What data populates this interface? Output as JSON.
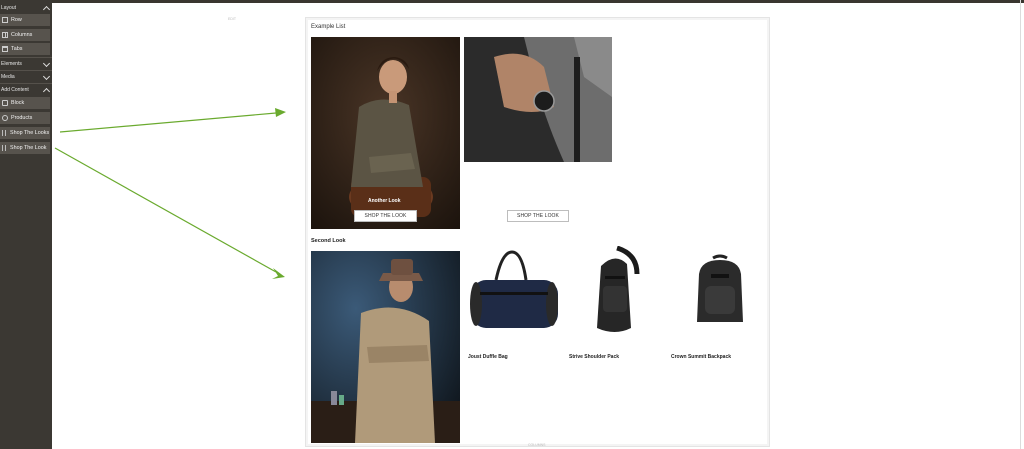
{
  "sidebar": {
    "sections": [
      {
        "label": "Layout",
        "expanded": true
      },
      {
        "label": "Elements",
        "expanded": false
      },
      {
        "label": "Media",
        "expanded": false
      },
      {
        "label": "Add Content",
        "expanded": true
      }
    ],
    "layout_items": [
      {
        "label": "Row",
        "icon": "row-icon"
      },
      {
        "label": "Columns",
        "icon": "columns-icon"
      },
      {
        "label": "Tabs",
        "icon": "tabs-icon"
      }
    ],
    "content_items": [
      {
        "label": "Block",
        "icon": "block-icon"
      },
      {
        "label": "Products",
        "icon": "products-icon"
      },
      {
        "label": "Shop The Looks",
        "icon": "grip-icon"
      },
      {
        "label": "Shop The Look",
        "icon": "grip-icon"
      }
    ]
  },
  "canvas": {
    "top_marker": "EDIT",
    "bottom_marker": "COLUMNS",
    "list_title": "Example List",
    "look_one": {
      "overlay_title": "Another Look",
      "button": "SHOP THE LOOK",
      "second_button": "SHOP THE LOOK"
    },
    "second_look": {
      "title": "Second Look",
      "products": [
        {
          "name": "Joust Duffle Bag"
        },
        {
          "name": "Strive Shoulder Pack"
        },
        {
          "name": "Crown Summit Backpack"
        }
      ]
    }
  },
  "colors": {
    "sidebar_bg": "#3b3833",
    "sidebar_item_bg": "#57534d",
    "arrow": "#6aaa2e"
  }
}
